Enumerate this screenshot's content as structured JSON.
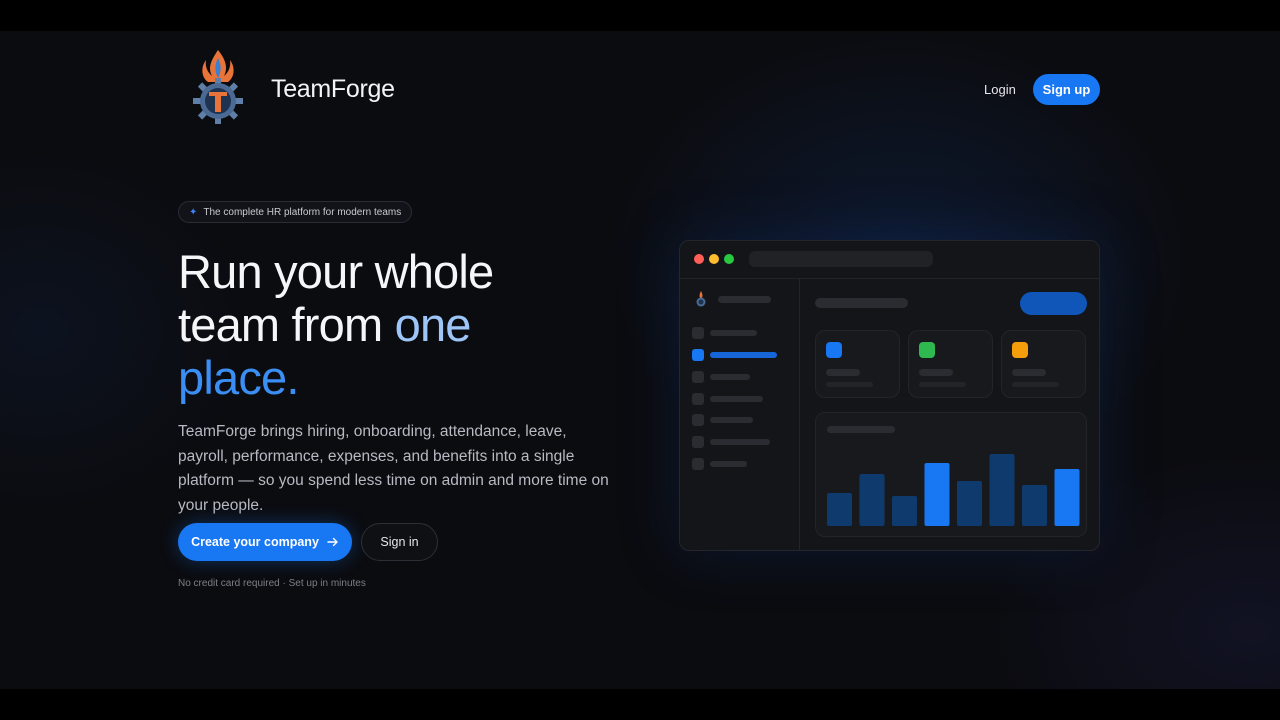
{
  "brand": {
    "name": "TeamForge",
    "logo_icon": "flame-gear-logo-icon"
  },
  "nav": {
    "login_label": "Login",
    "signup_label": "Sign up"
  },
  "hero": {
    "badge_icon": "sparkle-icon",
    "badge_text": "The complete HR platform for modern teams",
    "headline_line1": "Run your whole",
    "headline_line2_plain": "team from ",
    "headline_line2_accent": "one",
    "headline_line3_accent": "place.",
    "description": "TeamForge brings hiring, onboarding, attendance, leave, payroll, performance, expenses, and benefits into a single platform — so you spend less time on admin and more time on your people.",
    "cta_label": "Create your company",
    "cta_icon": "arrow-right-icon",
    "signin_label": "Sign in",
    "footnote": "No credit card required · Set up in minutes"
  },
  "mockup": {
    "window_dots": [
      "#ff5f57",
      "#febc2e",
      "#28c840"
    ],
    "stat_card_colors": [
      "#1877f2",
      "#2eb84f",
      "#f59e0b"
    ],
    "chart_data": {
      "type": "bar",
      "values": [
        3.3,
        5.2,
        3.0,
        6.3,
        4.5,
        7.2,
        4.1,
        5.7
      ],
      "highlighted": [
        false,
        false,
        false,
        true,
        false,
        false,
        false,
        true
      ],
      "ylim": [
        0,
        8
      ],
      "colors": {
        "bar": "#0f3a6e",
        "highlight": "#1877f2"
      }
    }
  }
}
